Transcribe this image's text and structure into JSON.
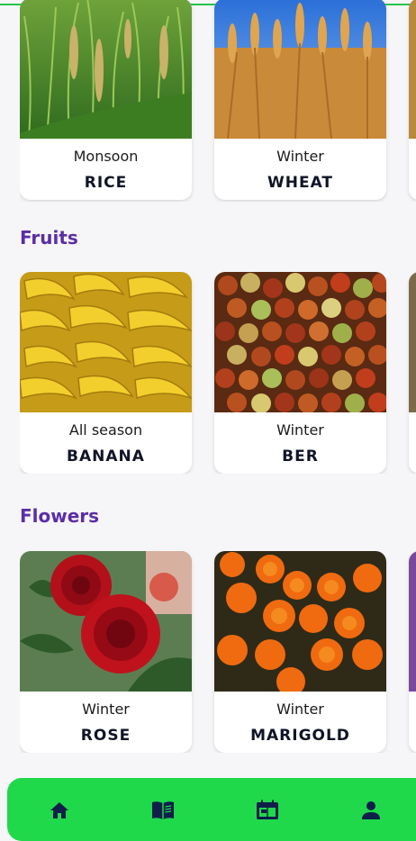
{
  "sections": [
    {
      "title": "",
      "cards": [
        {
          "season": "Monsoon",
          "name": "RICE",
          "image": "rice-field-image"
        },
        {
          "season": "Winter",
          "name": "WHEAT",
          "image": "wheat-field-image"
        }
      ]
    },
    {
      "title": "Fruits",
      "cards": [
        {
          "season": "All season",
          "name": "BANANA",
          "image": "banana-image"
        },
        {
          "season": "Winter",
          "name": "BER",
          "image": "ber-fruit-image"
        }
      ]
    },
    {
      "title": "Flowers",
      "cards": [
        {
          "season": "Winter",
          "name": "ROSE",
          "image": "rose-image"
        },
        {
          "season": "Winter",
          "name": "MARIGOLD",
          "image": "marigold-image"
        }
      ]
    }
  ],
  "bottom_nav": {
    "items": [
      {
        "icon": "home-icon"
      },
      {
        "icon": "book-icon"
      },
      {
        "icon": "calendar-icon"
      },
      {
        "icon": "person-icon"
      }
    ]
  },
  "colors": {
    "accent": "#1fd94a",
    "section_title": "#5b2ea6",
    "card_bg": "#ffffff",
    "nav_icon": "#0f1f4a"
  }
}
